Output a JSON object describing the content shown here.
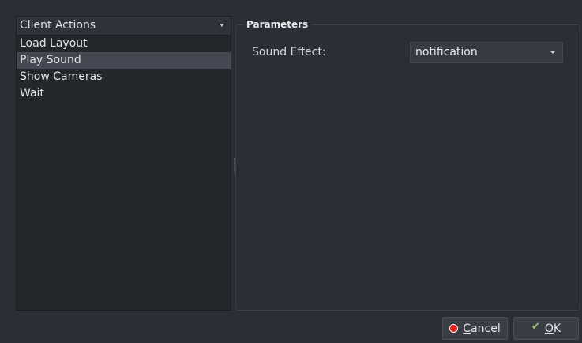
{
  "left_panel": {
    "combo_value": "Client Actions",
    "items": [
      {
        "label": "Load Layout",
        "selected": false
      },
      {
        "label": "Play Sound",
        "selected": true
      },
      {
        "label": "Show Cameras",
        "selected": false
      },
      {
        "label": "Wait",
        "selected": false
      }
    ]
  },
  "parameters": {
    "title": "Parameters",
    "sound_effect_label": "Sound Effect:",
    "sound_effect_value": "notification"
  },
  "buttons": {
    "cancel_mnemonic": "C",
    "cancel_rest": "ancel",
    "ok_mnemonic": "O",
    "ok_rest": "K"
  },
  "colors": {
    "background": "#2b2e34",
    "selection": "#454953",
    "cancel_icon": "#e0201c",
    "ok_icon": "#9bc36b"
  },
  "icons": [
    "chevron-down-icon",
    "cancel-icon",
    "ok-check-icon"
  ]
}
